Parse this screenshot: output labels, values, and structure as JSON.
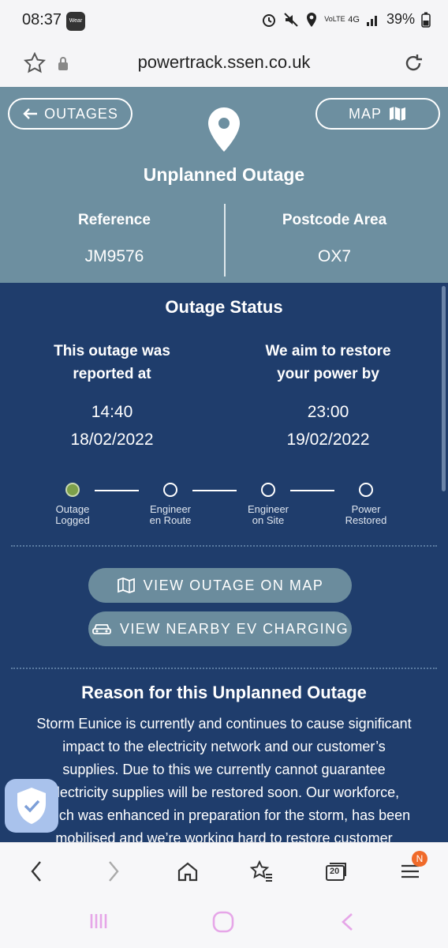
{
  "status_bar": {
    "time": "08:37",
    "wear_label": "Wear",
    "battery": "39%",
    "network": "4G",
    "volte": "VoLTE",
    "icons": [
      "alarm-icon",
      "mute-icon",
      "location-icon",
      "signal-icon",
      "battery-icon"
    ]
  },
  "browser": {
    "url": "powertrack.ssen.co.uk",
    "tabs_count": "20",
    "menu_badge": "N"
  },
  "header": {
    "back_label": "OUTAGES",
    "map_label": "MAP",
    "title": "Unplanned Outage",
    "reference_label": "Reference",
    "reference_value": "JM9576",
    "postcode_label": "Postcode Area",
    "postcode_value": "OX7",
    "colors": {
      "background": "#6d8fa0"
    }
  },
  "status": {
    "title": "Outage Status",
    "reported_label_1": "This outage was",
    "reported_label_2": "reported at",
    "reported_time": "14:40",
    "reported_date": "18/02/2022",
    "restore_label_1": "We aim to restore",
    "restore_label_2": "your power by",
    "restore_time": "23:00",
    "restore_date": "19/02/2022",
    "steps": [
      {
        "line1": "Outage",
        "line2": "Logged",
        "active": true
      },
      {
        "line1": "Engineer",
        "line2": "en Route",
        "active": false
      },
      {
        "line1": "Engineer",
        "line2": "on Site",
        "active": false
      },
      {
        "line1": "Power",
        "line2": "Restored",
        "active": false
      }
    ],
    "colors": {
      "background": "#1f3d6c",
      "active_step": "#7ca04a"
    }
  },
  "actions": {
    "view_map_label": "VIEW OUTAGE ON MAP",
    "ev_label": "VIEW NEARBY EV CHARGING"
  },
  "reason": {
    "title": "Reason for this Unplanned Outage",
    "lines": [
      "Storm Eunice is currently and continues to cause significant",
      "impact to the electricity network and our customer’s",
      "supplies. Due to this we currently cannot guarantee",
      "electricity supplies will be restored soon. Our workforce,",
      "which was enhanced in preparation for the storm, has been",
      "mobilised and we’re working hard to restore customer"
    ]
  }
}
